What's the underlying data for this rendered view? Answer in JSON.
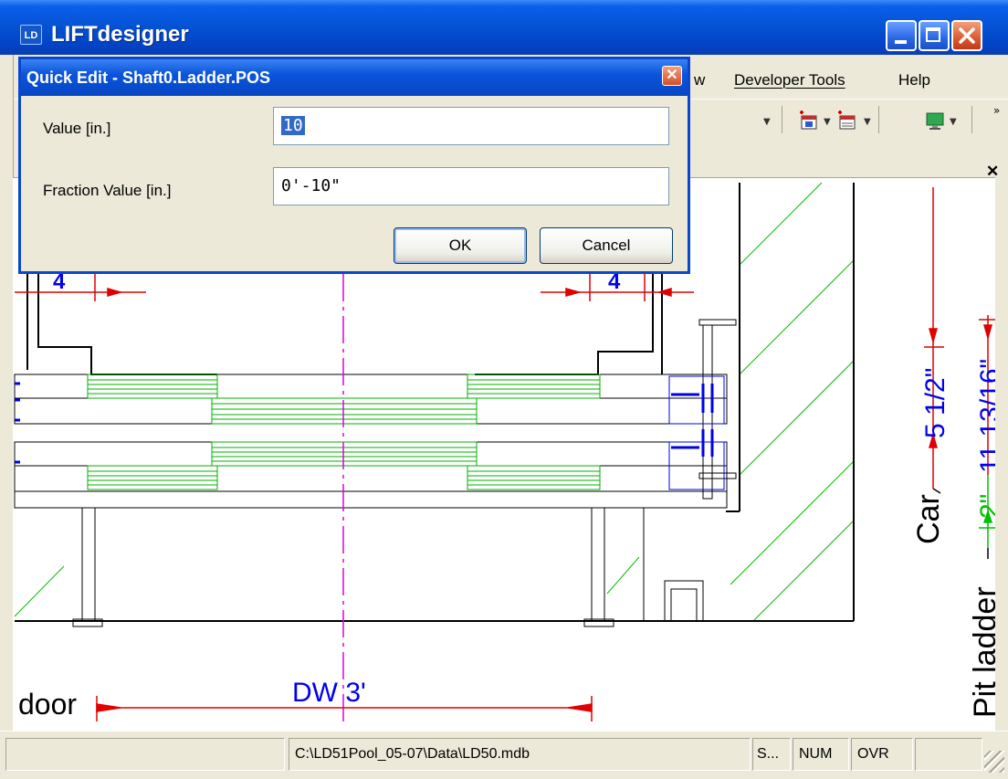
{
  "window": {
    "title": "LIFTdesigner",
    "icon_text": "LD"
  },
  "menu": {
    "items": [
      "w",
      "Developer Tools",
      "Help"
    ]
  },
  "dialog": {
    "title": "Quick Edit - Shaft0.Ladder.POS",
    "value_label": "Value [in.]",
    "value": "10",
    "fraction_label": "Fraction Value [in.]",
    "fraction_value": "0'-10\"",
    "ok_label": "OK",
    "cancel_label": "Cancel"
  },
  "drawing": {
    "dim_left": "4",
    "dim_right": "4",
    "door_label": "door",
    "dw_label": "DW 3'",
    "car_label": "Car",
    "car_dim": "5 1/2\"",
    "pit_label": "Pit ladder",
    "pit_dim_top": "11 13/16\"",
    "pit_dim_bottom": "2\""
  },
  "statusbar": {
    "path": "C:\\LD51Pool_05-07\\Data\\LD50.mdb",
    "pane_s": "S...",
    "pane_num": "NUM",
    "pane_ovr": "OVR"
  },
  "colors": {
    "titlebar": "#0553d6",
    "dimension": "#e00000",
    "blue_text": "#0000ff",
    "hatch": "#00c000",
    "axis": "#e000e0"
  }
}
